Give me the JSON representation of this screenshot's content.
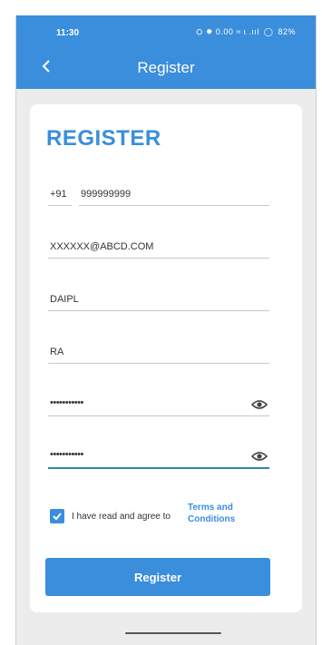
{
  "status_bar": {
    "time": "11:30",
    "icons_text": "⛭ ✸ 0.00 ≈ ɩ .ııl",
    "battery": "82%"
  },
  "app_bar": {
    "title": "Register"
  },
  "form": {
    "heading": "REGISTER",
    "country_code": "+91",
    "phone": "999999999",
    "email": "XXXXXX@ABCD.COM",
    "company": "DAIPL",
    "name": "RA",
    "password_mask": "•••••••••••",
    "confirm_password_mask": "•••••••••••",
    "consent_text": "I have read and agree to",
    "terms_line1": "Terms and",
    "terms_line2": "Conditions",
    "consent_checked": true,
    "submit_label": "Register"
  },
  "colors": {
    "primary": "#3a8edc",
    "active_underline": "#2a8ba4",
    "background": "#ececec",
    "card": "#ffffff"
  },
  "icons": {
    "back": "chevron-left-icon",
    "eye": "eye-icon",
    "check": "check-icon"
  }
}
